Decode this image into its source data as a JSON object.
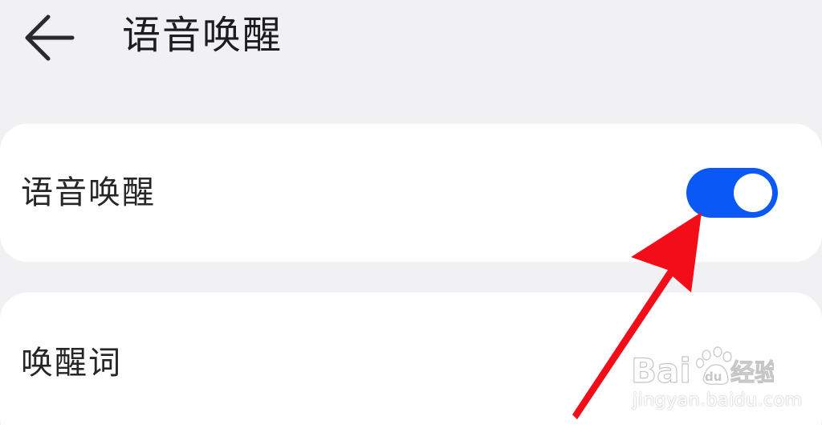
{
  "header": {
    "back_icon": "arrow-left-icon",
    "title": "语音唤醒"
  },
  "settings": {
    "voice_wakeup": {
      "label": "语音唤醒",
      "enabled": true
    },
    "wake_word": {
      "label": "唤醒词"
    }
  },
  "annotation": {
    "arrow_icon": "red-arrow-icon",
    "color": "#f20d18"
  },
  "watermark": {
    "logo_text": "Baidu经验",
    "url": "jingyan.baidu.com"
  },
  "colors": {
    "background": "#f1f1f3",
    "card": "#ffffff",
    "toggle_on": "#0a59f7",
    "text": "#1d1d1f"
  }
}
